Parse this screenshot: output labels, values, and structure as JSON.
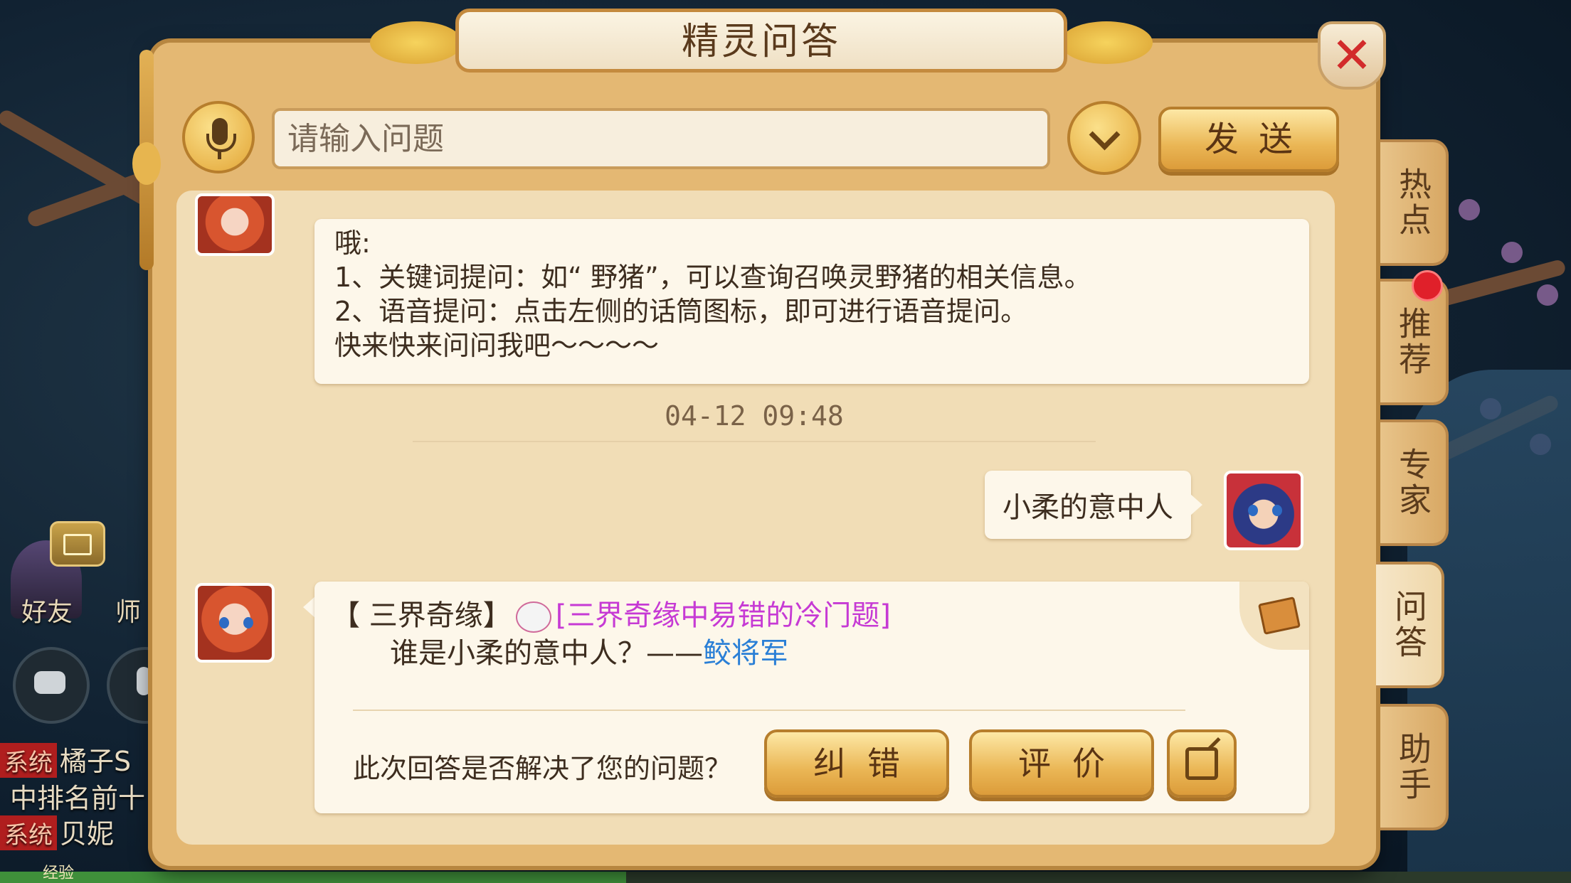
{
  "dialog": {
    "title": "精灵问答",
    "close_icon": "close-icon"
  },
  "input_row": {
    "question_placeholder": "请输入问题",
    "send_label": "发送"
  },
  "side_tabs": [
    "热点",
    "推荐",
    "专家",
    "问答",
    "助手"
  ],
  "active_tab": "问答",
  "chat": {
    "intro": {
      "line1": "哦:",
      "line2": "1、关键词提问：如“ 野猪”，可以查询召唤灵野猪的相关信息。",
      "line3": "2、语音提问：点击左侧的话筒图标，即可进行语音提问。",
      "line4": "快来快来问问我吧～～～～"
    },
    "timestamp": "04-12 09:48",
    "user_message": "小柔的意中人",
    "answer": {
      "tag": "【 三界奇缘】",
      "link_title": "[三界奇缘中易错的冷门题]",
      "question": "谁是小柔的意中人？——",
      "answer_text": "鲛将军"
    },
    "feedback": {
      "question": "此次回答是否解决了您的问题？",
      "fix_label": "纠错",
      "rate_label": "评价"
    }
  },
  "hud": {
    "friends_label": "好友",
    "master_label": "师",
    "chat_lines": [
      {
        "tag": "系统",
        "text": "橘子S"
      },
      {
        "tag": "",
        "text": "中排名前十"
      },
      {
        "tag": "系统",
        "text": "贝妮"
      }
    ],
    "xp_label": "经验"
  },
  "colors": {
    "panel": "#e4b873",
    "panel_inner": "#f1ddb6",
    "button_gold": "#eab655",
    "link_blue": "#2a7fd6",
    "link_pink": "#c63ad4",
    "close_red": "#d22b2b"
  }
}
